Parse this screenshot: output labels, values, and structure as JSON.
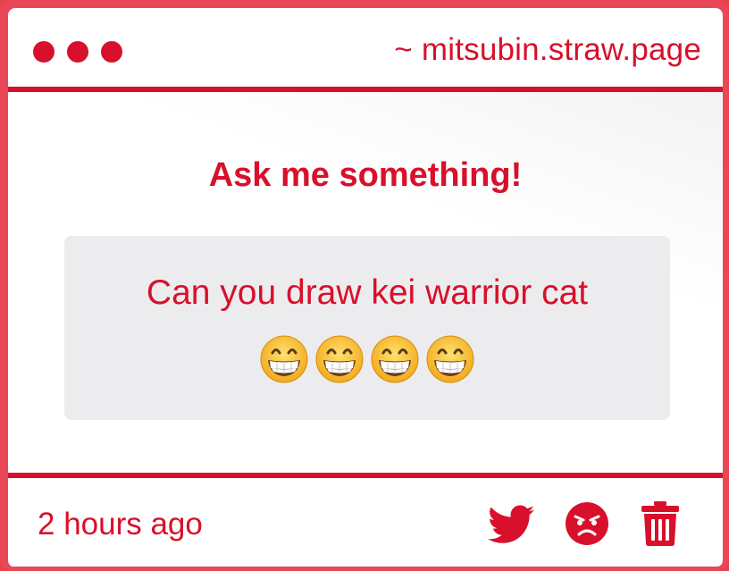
{
  "window": {
    "url": "~ mitsubin.straw.page",
    "dots": [
      "dot-1",
      "dot-2",
      "dot-3"
    ]
  },
  "main": {
    "heading": "Ask me something!",
    "question": "Can you draw kei warrior cat",
    "emoji_count": 4,
    "emoji_icon": "grinning-face-icon"
  },
  "footer": {
    "timestamp": "2 hours ago",
    "actions": [
      {
        "icon": "twitter-icon"
      },
      {
        "icon": "angry-face-icon"
      },
      {
        "icon": "trash-icon"
      }
    ]
  },
  "colors": {
    "accent": "#d8102b",
    "frame": "#e84855",
    "question_bg": "#ececee"
  }
}
